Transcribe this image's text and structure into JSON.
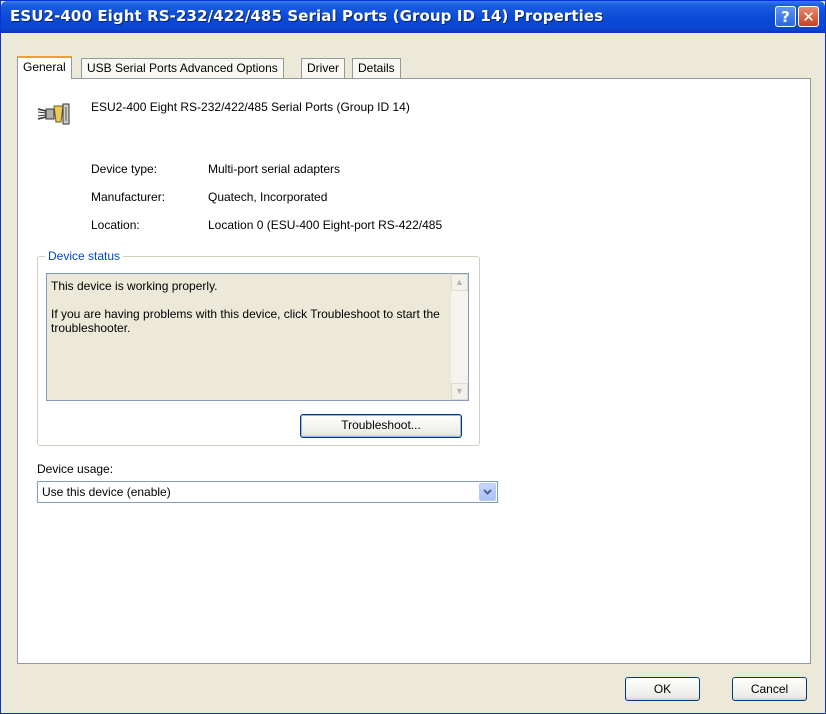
{
  "window": {
    "title": "ESU2-400 Eight RS-232/422/485 Serial Ports (Group ID 14) Properties",
    "help_label": "?",
    "close_label": "✕"
  },
  "tabs": [
    {
      "label": "General",
      "active": true
    },
    {
      "label": "USB Serial Ports Advanced Options",
      "active": false
    },
    {
      "label": "Driver",
      "active": false
    },
    {
      "label": "Details",
      "active": false
    }
  ],
  "device": {
    "icon": "serial-port-icon",
    "name": "ESU2-400 Eight RS-232/422/485 Serial Ports (Group ID 14)"
  },
  "properties": [
    {
      "label": "Device type:",
      "value": "Multi-port serial adapters"
    },
    {
      "label": "Manufacturer:",
      "value": "Quatech, Incorporated"
    },
    {
      "label": "Location:",
      "value": "Location 0 (ESU-400 Eight-port RS-422/485"
    }
  ],
  "status": {
    "legend": "Device status",
    "line1": "This device is working properly.",
    "line2": "If you are having problems with this device, click Troubleshoot to start the troubleshooter.",
    "troubleshoot_label": "Troubleshoot..."
  },
  "usage": {
    "label": "Device usage:",
    "selected": "Use this device (enable)"
  },
  "footer": {
    "ok_label": "OK",
    "cancel_label": "Cancel"
  },
  "colors": {
    "title_bar": "#0b4bd8",
    "dialog_face": "#ece9d8",
    "group_legend": "#0046d5",
    "active_tab_accent": "#e9a23a"
  }
}
